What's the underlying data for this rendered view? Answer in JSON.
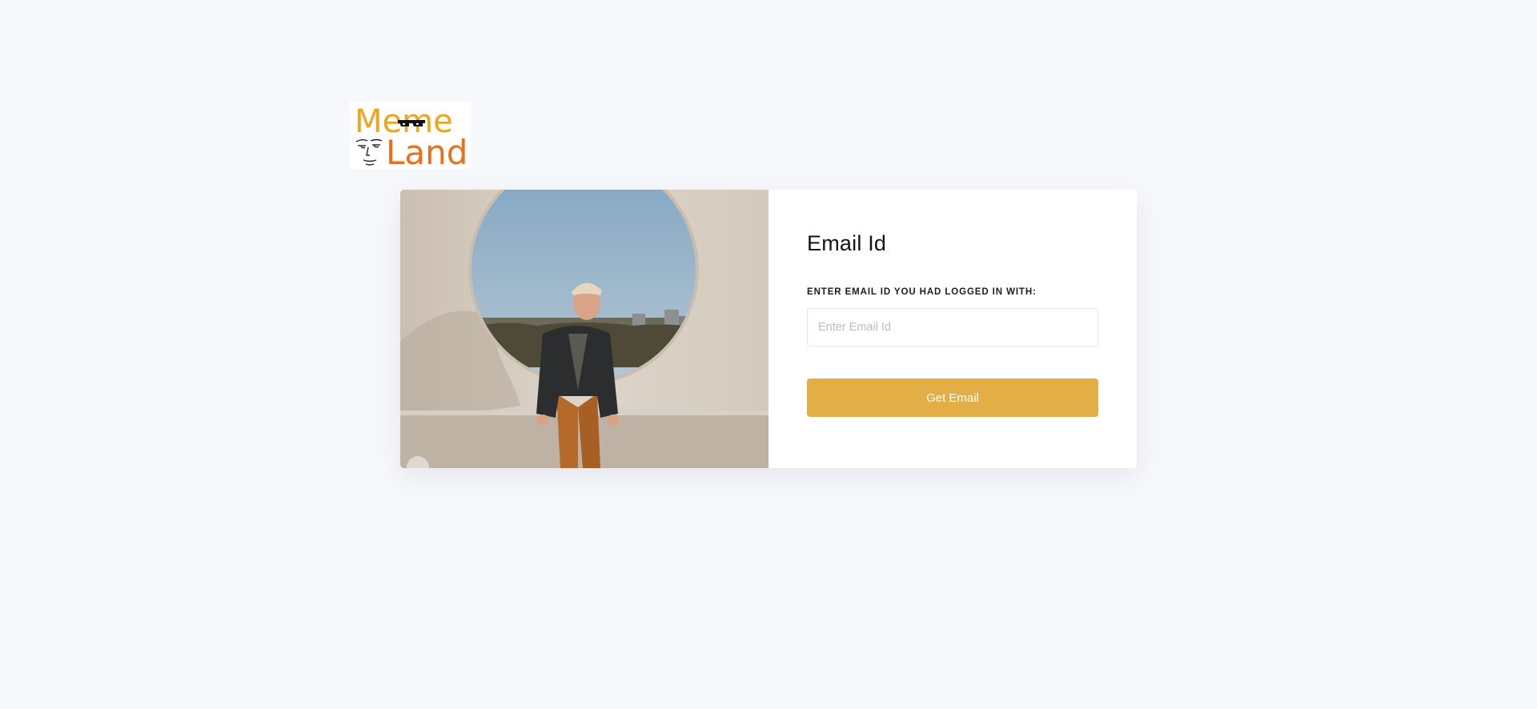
{
  "logo": {
    "word1": "Meme",
    "word2": "Land",
    "colors": {
      "meme": "#f0a41e",
      "land": "#e8711e"
    }
  },
  "form": {
    "title": "Email Id",
    "label": "ENTER EMAIL ID YOU HAD LOGGED IN WITH:",
    "email_value": "",
    "email_placeholder": "Enter Email Id",
    "submit_label": "Get Email"
  },
  "colors": {
    "background": "#f7f8fc",
    "accent": "#e4ae47"
  }
}
